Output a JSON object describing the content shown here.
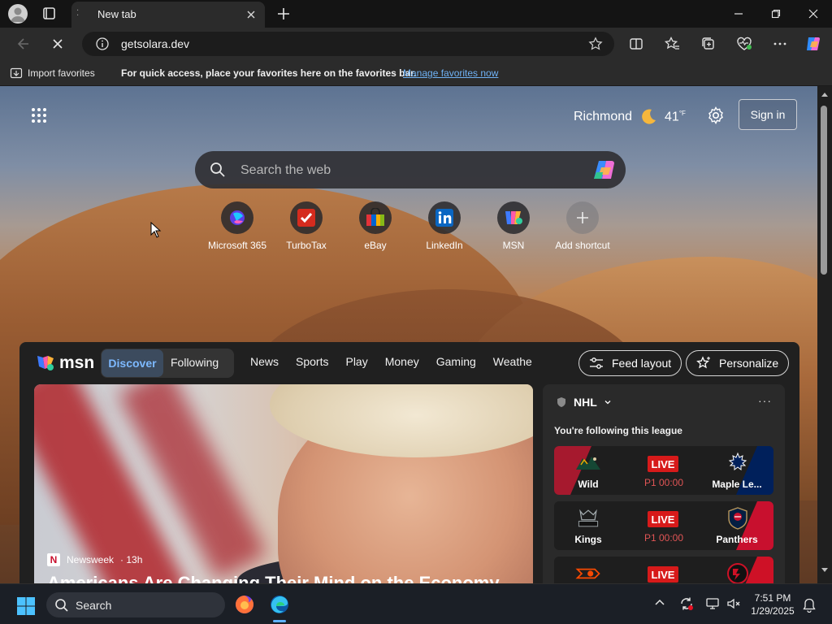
{
  "browser": {
    "tab": {
      "title": "New tab"
    },
    "address": {
      "url": "getsolara.dev"
    }
  },
  "favorites_bar": {
    "import_label": "Import favorites",
    "message": "For quick access, place your favorites here on the favorites bar.",
    "manage_link": "Manage favorites now"
  },
  "newtab": {
    "weather": {
      "city": "Richmond",
      "temp": "41",
      "unit": "°F"
    },
    "sign_in": "Sign in",
    "search": {
      "placeholder": "Search the web"
    },
    "shortcuts": [
      {
        "label": "Microsoft 365",
        "icon": "microsoft365-icon"
      },
      {
        "label": "TurboTax",
        "icon": "turbotax-icon"
      },
      {
        "label": "eBay",
        "icon": "ebay-icon"
      },
      {
        "label": "LinkedIn",
        "icon": "linkedin-icon"
      },
      {
        "label": "MSN",
        "icon": "msn-icon"
      },
      {
        "label": "Add shortcut",
        "icon": "plus-icon"
      }
    ]
  },
  "feed": {
    "brand": "msn",
    "segments": {
      "discover": "Discover",
      "following": "Following"
    },
    "nav": [
      "News",
      "Sports",
      "Play",
      "Money",
      "Gaming",
      "Weathe"
    ],
    "feed_layout": "Feed layout",
    "personalize": "Personalize",
    "hero": {
      "source": "Newsweek",
      "age": "· 13h",
      "title": "Americans Are Changing Their Mind on the Economy"
    },
    "nhl": {
      "title": "NHL",
      "more": "···",
      "subtitle": "You're following this league",
      "games": [
        {
          "home": "Wild",
          "away": "Maple Le...",
          "status": "LIVE",
          "period": "P1 00:00"
        },
        {
          "home": "Kings",
          "away": "Panthers",
          "status": "LIVE",
          "period": "P1 00:00"
        },
        {
          "home": "Flyers",
          "away": "Devils",
          "status": "LIVE",
          "period": ""
        }
      ]
    }
  },
  "taskbar": {
    "search_label": "Search",
    "time": "7:51 PM",
    "date": "1/29/2025"
  },
  "colors": {
    "accent": "#7db9ff",
    "link": "#6fb2f5",
    "live": "#d71a1a"
  }
}
